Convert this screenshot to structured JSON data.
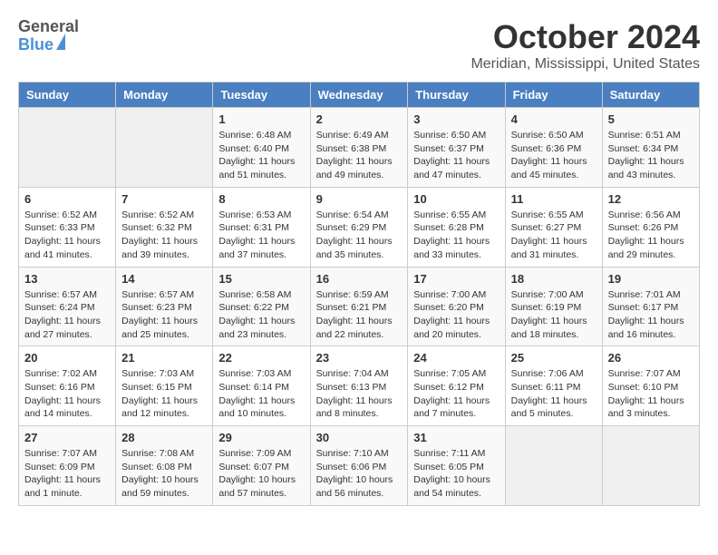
{
  "header": {
    "logo": {
      "line1": "General",
      "line2": "Blue"
    },
    "title": "October 2024",
    "subtitle": "Meridian, Mississippi, United States"
  },
  "calendar": {
    "weekdays": [
      "Sunday",
      "Monday",
      "Tuesday",
      "Wednesday",
      "Thursday",
      "Friday",
      "Saturday"
    ],
    "weeks": [
      [
        {
          "day": "",
          "info": ""
        },
        {
          "day": "",
          "info": ""
        },
        {
          "day": "1",
          "info": "Sunrise: 6:48 AM\nSunset: 6:40 PM\nDaylight: 11 hours and 51 minutes."
        },
        {
          "day": "2",
          "info": "Sunrise: 6:49 AM\nSunset: 6:38 PM\nDaylight: 11 hours and 49 minutes."
        },
        {
          "day": "3",
          "info": "Sunrise: 6:50 AM\nSunset: 6:37 PM\nDaylight: 11 hours and 47 minutes."
        },
        {
          "day": "4",
          "info": "Sunrise: 6:50 AM\nSunset: 6:36 PM\nDaylight: 11 hours and 45 minutes."
        },
        {
          "day": "5",
          "info": "Sunrise: 6:51 AM\nSunset: 6:34 PM\nDaylight: 11 hours and 43 minutes."
        }
      ],
      [
        {
          "day": "6",
          "info": "Sunrise: 6:52 AM\nSunset: 6:33 PM\nDaylight: 11 hours and 41 minutes."
        },
        {
          "day": "7",
          "info": "Sunrise: 6:52 AM\nSunset: 6:32 PM\nDaylight: 11 hours and 39 minutes."
        },
        {
          "day": "8",
          "info": "Sunrise: 6:53 AM\nSunset: 6:31 PM\nDaylight: 11 hours and 37 minutes."
        },
        {
          "day": "9",
          "info": "Sunrise: 6:54 AM\nSunset: 6:29 PM\nDaylight: 11 hours and 35 minutes."
        },
        {
          "day": "10",
          "info": "Sunrise: 6:55 AM\nSunset: 6:28 PM\nDaylight: 11 hours and 33 minutes."
        },
        {
          "day": "11",
          "info": "Sunrise: 6:55 AM\nSunset: 6:27 PM\nDaylight: 11 hours and 31 minutes."
        },
        {
          "day": "12",
          "info": "Sunrise: 6:56 AM\nSunset: 6:26 PM\nDaylight: 11 hours and 29 minutes."
        }
      ],
      [
        {
          "day": "13",
          "info": "Sunrise: 6:57 AM\nSunset: 6:24 PM\nDaylight: 11 hours and 27 minutes."
        },
        {
          "day": "14",
          "info": "Sunrise: 6:57 AM\nSunset: 6:23 PM\nDaylight: 11 hours and 25 minutes."
        },
        {
          "day": "15",
          "info": "Sunrise: 6:58 AM\nSunset: 6:22 PM\nDaylight: 11 hours and 23 minutes."
        },
        {
          "day": "16",
          "info": "Sunrise: 6:59 AM\nSunset: 6:21 PM\nDaylight: 11 hours and 22 minutes."
        },
        {
          "day": "17",
          "info": "Sunrise: 7:00 AM\nSunset: 6:20 PM\nDaylight: 11 hours and 20 minutes."
        },
        {
          "day": "18",
          "info": "Sunrise: 7:00 AM\nSunset: 6:19 PM\nDaylight: 11 hours and 18 minutes."
        },
        {
          "day": "19",
          "info": "Sunrise: 7:01 AM\nSunset: 6:17 PM\nDaylight: 11 hours and 16 minutes."
        }
      ],
      [
        {
          "day": "20",
          "info": "Sunrise: 7:02 AM\nSunset: 6:16 PM\nDaylight: 11 hours and 14 minutes."
        },
        {
          "day": "21",
          "info": "Sunrise: 7:03 AM\nSunset: 6:15 PM\nDaylight: 11 hours and 12 minutes."
        },
        {
          "day": "22",
          "info": "Sunrise: 7:03 AM\nSunset: 6:14 PM\nDaylight: 11 hours and 10 minutes."
        },
        {
          "day": "23",
          "info": "Sunrise: 7:04 AM\nSunset: 6:13 PM\nDaylight: 11 hours and 8 minutes."
        },
        {
          "day": "24",
          "info": "Sunrise: 7:05 AM\nSunset: 6:12 PM\nDaylight: 11 hours and 7 minutes."
        },
        {
          "day": "25",
          "info": "Sunrise: 7:06 AM\nSunset: 6:11 PM\nDaylight: 11 hours and 5 minutes."
        },
        {
          "day": "26",
          "info": "Sunrise: 7:07 AM\nSunset: 6:10 PM\nDaylight: 11 hours and 3 minutes."
        }
      ],
      [
        {
          "day": "27",
          "info": "Sunrise: 7:07 AM\nSunset: 6:09 PM\nDaylight: 11 hours and 1 minute."
        },
        {
          "day": "28",
          "info": "Sunrise: 7:08 AM\nSunset: 6:08 PM\nDaylight: 10 hours and 59 minutes."
        },
        {
          "day": "29",
          "info": "Sunrise: 7:09 AM\nSunset: 6:07 PM\nDaylight: 10 hours and 57 minutes."
        },
        {
          "day": "30",
          "info": "Sunrise: 7:10 AM\nSunset: 6:06 PM\nDaylight: 10 hours and 56 minutes."
        },
        {
          "day": "31",
          "info": "Sunrise: 7:11 AM\nSunset: 6:05 PM\nDaylight: 10 hours and 54 minutes."
        },
        {
          "day": "",
          "info": ""
        },
        {
          "day": "",
          "info": ""
        }
      ]
    ]
  }
}
